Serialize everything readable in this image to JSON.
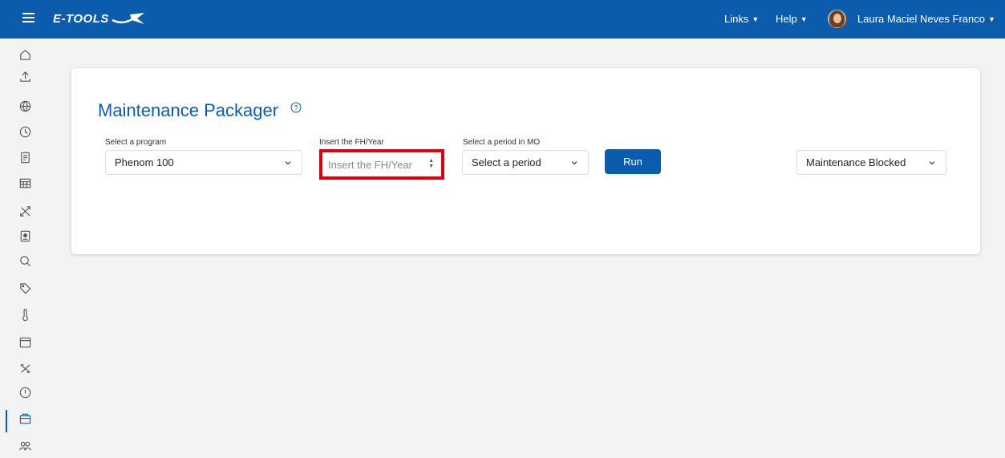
{
  "header": {
    "brand": "E-TOOLS",
    "links_label": "Links",
    "help_label": "Help",
    "user_name": "Laura Maciel Neves Franco"
  },
  "sidebar": {
    "icons": [
      "home-icon",
      "upload-icon",
      "globe-icon",
      "clock-icon",
      "document-icon",
      "table-icon",
      "tools-icon",
      "id-card-icon",
      "search-icon",
      "tag-icon",
      "thermometer-icon",
      "calendar-icon",
      "plane-icon",
      "alert-icon",
      "package-icon",
      "users-icon"
    ],
    "active": "package-icon"
  },
  "main": {
    "title": "Maintenance Packager",
    "program": {
      "label": "Select a program",
      "value": "Phenom 100"
    },
    "fh_year": {
      "label": "Insert the FH/Year",
      "placeholder": "Insert the FH/Year"
    },
    "period": {
      "label": "Select a period in MO",
      "value": "Select a period"
    },
    "run_label": "Run",
    "status": {
      "value": "Maintenance Blocked"
    }
  },
  "colors": {
    "brand": "#0b5cad",
    "highlight": "#e0000b"
  }
}
